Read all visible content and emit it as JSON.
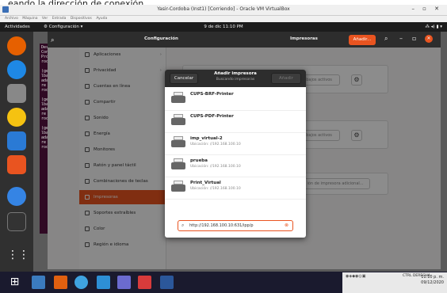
{
  "caption": "eando la dirección de conexión.",
  "vbox": {
    "title": "Yasir-Cordoba (Inst1) [Corriendo] - Oracle VM VirtualBox",
    "menu": [
      "Archivo",
      "Máquina",
      "Ver",
      "Entrada",
      "Dispositivos",
      "Ayuda"
    ]
  },
  "topbar": {
    "activities": "Actividades",
    "app": "Configuración ▾",
    "clock": "9 de dic 11:10 PM"
  },
  "settings": {
    "title": "Configuración",
    "panel_title": "Impresoras",
    "add_label": "Añadir...",
    "sidebar": [
      {
        "label": "Aplicaciones",
        "icon": "apps-icon",
        "chevron": true
      },
      {
        "label": "Privacidad",
        "icon": "privacy-icon",
        "chevron": true
      },
      {
        "label": "Cuentas en línea",
        "icon": "cloud-icon",
        "chevron": false
      },
      {
        "label": "Compartir",
        "icon": "share-icon",
        "chevron": false
      },
      {
        "label": "Sonido",
        "icon": "music-icon",
        "chevron": false
      },
      {
        "label": "Energía",
        "icon": "power-icon",
        "chevron": false
      },
      {
        "label": "Monitores",
        "icon": "monitor-icon",
        "chevron": false
      },
      {
        "label": "Ratón y panel táctil",
        "icon": "mouse-icon",
        "chevron": false
      },
      {
        "label": "Combinaciones de teclas",
        "icon": "keyboard-icon",
        "chevron": false
      },
      {
        "label": "Impresoras",
        "icon": "printer-icon",
        "chevron": false,
        "active": true
      },
      {
        "label": "Soportes extraíbles",
        "icon": "media-icon",
        "chevron": false
      },
      {
        "label": "Color",
        "icon": "color-icon",
        "chevron": false
      },
      {
        "label": "Región e idioma",
        "icon": "globe-icon",
        "chevron": false
      }
    ],
    "jobs_label": "trabajos activos",
    "more_label": "ión de impresora adicional..."
  },
  "terminal_lines": [
    "Desempaque",
    "Configurar",
    "Procesando",
    "root@userd",
    "",
    "(gedit:565",
    "lback to",
    "adata are",
    "re Tepl wi",
    "root@userd",
    "",
    "(gedit:582",
    "lback to",
    "adata are",
    "re Tepl wi",
    "root@userd",
    "",
    "(gedit:596",
    "lback to",
    "adata are",
    "re Tepl wi",
    "root@userd"
  ],
  "dialog": {
    "cancel": "Cancelar",
    "title": "Añadir impresora",
    "subtitle": "Buscando impresoras",
    "add": "Añadir",
    "printers": [
      {
        "name": "CUPS-BRF-Printer",
        "location": ""
      },
      {
        "name": "CUPS-PDF-Printer",
        "location": ""
      },
      {
        "name": "imp_virtual-2",
        "location": "Ubicación: //192.168.100.10"
      },
      {
        "name": "prueba",
        "location": "Ubicación: //192.168.100.10"
      },
      {
        "name": "Print_Virtual",
        "location": "Ubicación: //192.168.100.10"
      }
    ],
    "search_value": "http://192.168.100.10:631/ipp/p"
  },
  "tray": {
    "label": "CTRL DERECHA",
    "time": "11:10 p. m.",
    "date": "09/12/2020"
  },
  "colors": {
    "accent": "#e95420",
    "topbar": "#1c1c1c",
    "dock": "#303030"
  }
}
